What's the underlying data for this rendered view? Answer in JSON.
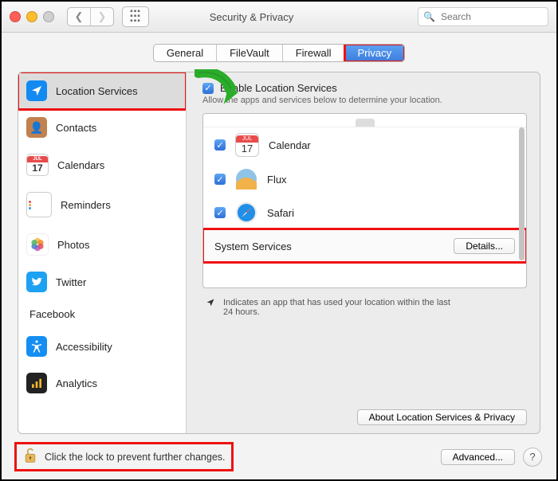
{
  "window": {
    "title": "Security & Privacy"
  },
  "search": {
    "placeholder": "Search"
  },
  "tabs": [
    {
      "label": "General",
      "active": false
    },
    {
      "label": "FileVault",
      "active": false
    },
    {
      "label": "Firewall",
      "active": false
    },
    {
      "label": "Privacy",
      "active": true
    }
  ],
  "sidebar": {
    "items": [
      {
        "label": "Location Services",
        "selected": true
      },
      {
        "label": "Contacts"
      },
      {
        "label": "Calendars"
      },
      {
        "label": "Reminders"
      },
      {
        "label": "Photos"
      },
      {
        "label": "Twitter"
      },
      {
        "label": "Facebook"
      },
      {
        "label": "Accessibility"
      },
      {
        "label": "Analytics"
      }
    ]
  },
  "content": {
    "enable_label": "Enable Location Services",
    "enable_sub": "Allow the apps and services below to determine your location.",
    "apps": [
      {
        "label": "Calendar",
        "checked": true
      },
      {
        "label": "Flux",
        "checked": true
      },
      {
        "label": "Safari",
        "checked": true
      }
    ],
    "system_services_label": "System Services",
    "details_label": "Details...",
    "indicator_note": "Indicates an app that has used your location within the last 24 hours.",
    "about_label": "About Location Services & Privacy"
  },
  "footer": {
    "lock_text": "Click the lock to prevent further changes.",
    "advanced_label": "Advanced..."
  }
}
